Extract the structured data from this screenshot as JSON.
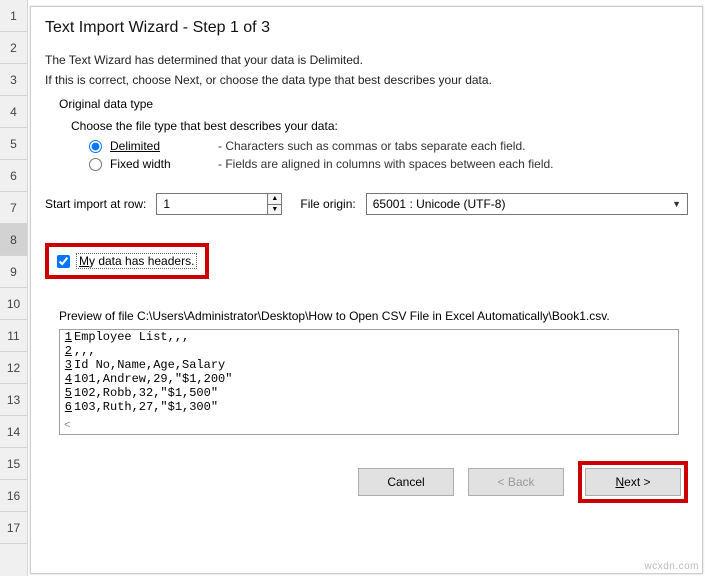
{
  "sheet": {
    "rows": [
      "1",
      "2",
      "3",
      "4",
      "5",
      "6",
      "7",
      "8",
      "9",
      "10",
      "11",
      "12",
      "13",
      "14",
      "15",
      "16",
      "17"
    ],
    "selected_index": 7
  },
  "dialog": {
    "title": "Text Import Wizard - Step 1 of 3",
    "line1": "The Text Wizard has determined that your data is Delimited.",
    "line2": "If this is correct, choose Next, or choose the data type that best describes your data.",
    "original_label": "Original data type",
    "choose_label": "Choose the file type that best describes your data:",
    "radios": {
      "delimited": {
        "label": "Delimited",
        "desc": "- Characters such as commas or tabs separate each field."
      },
      "fixed": {
        "label": "Fixed width",
        "desc": "- Fields are aligned in columns with spaces between each field."
      }
    },
    "start_row_label": "Start import at row:",
    "start_row_value": "1",
    "file_origin_label": "File origin:",
    "file_origin_value": "65001 : Unicode (UTF-8)",
    "headers_label": "My data has headers.",
    "preview_label": "Preview of file C:\\Users\\Administrator\\Desktop\\How to Open CSV File in Excel Automatically\\Book1.csv.",
    "preview_lines": [
      "Employee List,,,",
      ",,,",
      "Id No,Name,Age,Salary",
      "101,Andrew,29,\"$1,200\"",
      "102,Robb,32,\"$1,500\"",
      "103,Ruth,27,\"$1,300\""
    ],
    "buttons": {
      "cancel": "Cancel",
      "back": "< Back",
      "next_prefix": "N",
      "next_rest": "ext >"
    }
  },
  "watermark": "wcxdn.com"
}
